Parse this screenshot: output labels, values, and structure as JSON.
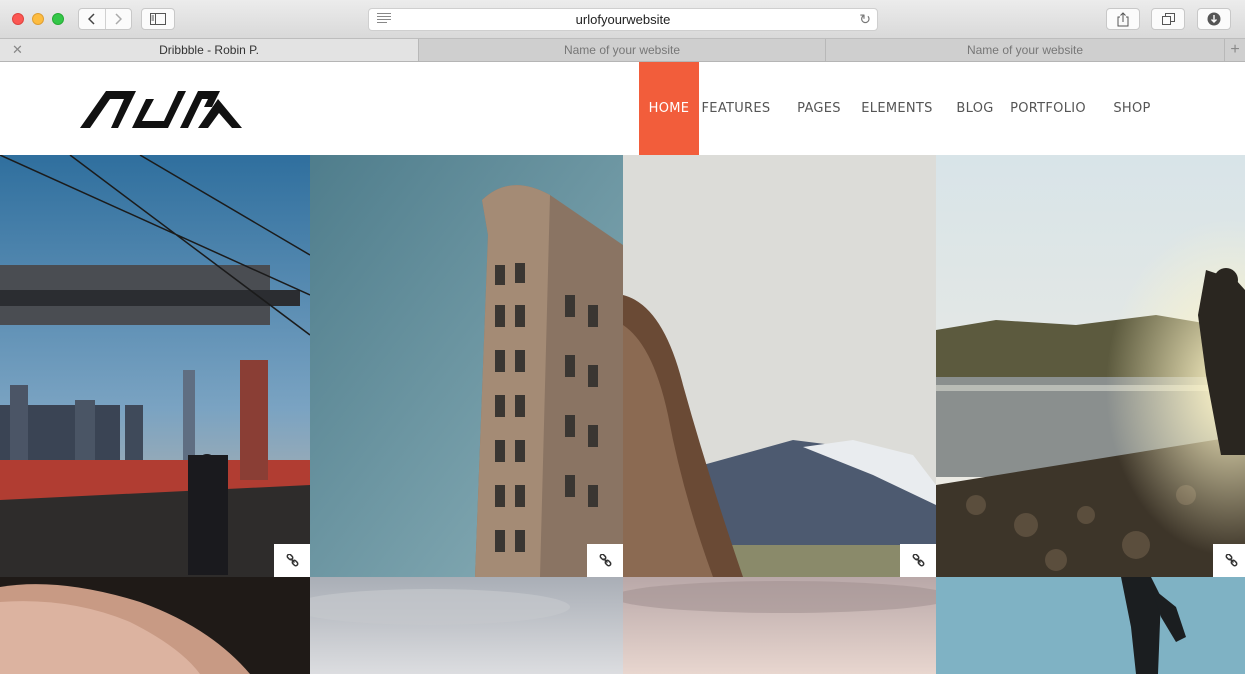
{
  "browser": {
    "url": "urlofyourwebsite",
    "tabs": [
      {
        "label": "Dribbble  -  Robin P.",
        "active": true
      },
      {
        "label": "Name of your website",
        "active": false
      },
      {
        "label": "Name of your website",
        "active": false
      }
    ],
    "new_tab_label": "+"
  },
  "site": {
    "logo_text": "AURA",
    "accent_color": "#f25d3b",
    "nav": [
      {
        "label": "HOME",
        "active": true
      },
      {
        "label": "FEATURES",
        "active": false
      },
      {
        "label": "PAGES",
        "active": false
      },
      {
        "label": "ELEMENTS",
        "active": false
      },
      {
        "label": "BLOG",
        "active": false
      },
      {
        "label": "PORTFOLIO",
        "active": false
      },
      {
        "label": "SHOP",
        "active": false
      }
    ]
  },
  "gallery": {
    "row1": [
      {
        "subject": "brooklyn-bridge-photo",
        "icon": "link-icon"
      },
      {
        "subject": "flatiron-building-photo",
        "icon": "link-icon"
      },
      {
        "subject": "hair-and-mountain-photo",
        "icon": "link-icon"
      },
      {
        "subject": "man-at-shore-photo",
        "icon": "link-icon"
      }
    ],
    "row2": [
      {
        "subject": "hand-photo"
      },
      {
        "subject": "cloudy-sky-photo"
      },
      {
        "subject": "pink-sky-photo"
      },
      {
        "subject": "person-silhouette-photo"
      }
    ]
  }
}
